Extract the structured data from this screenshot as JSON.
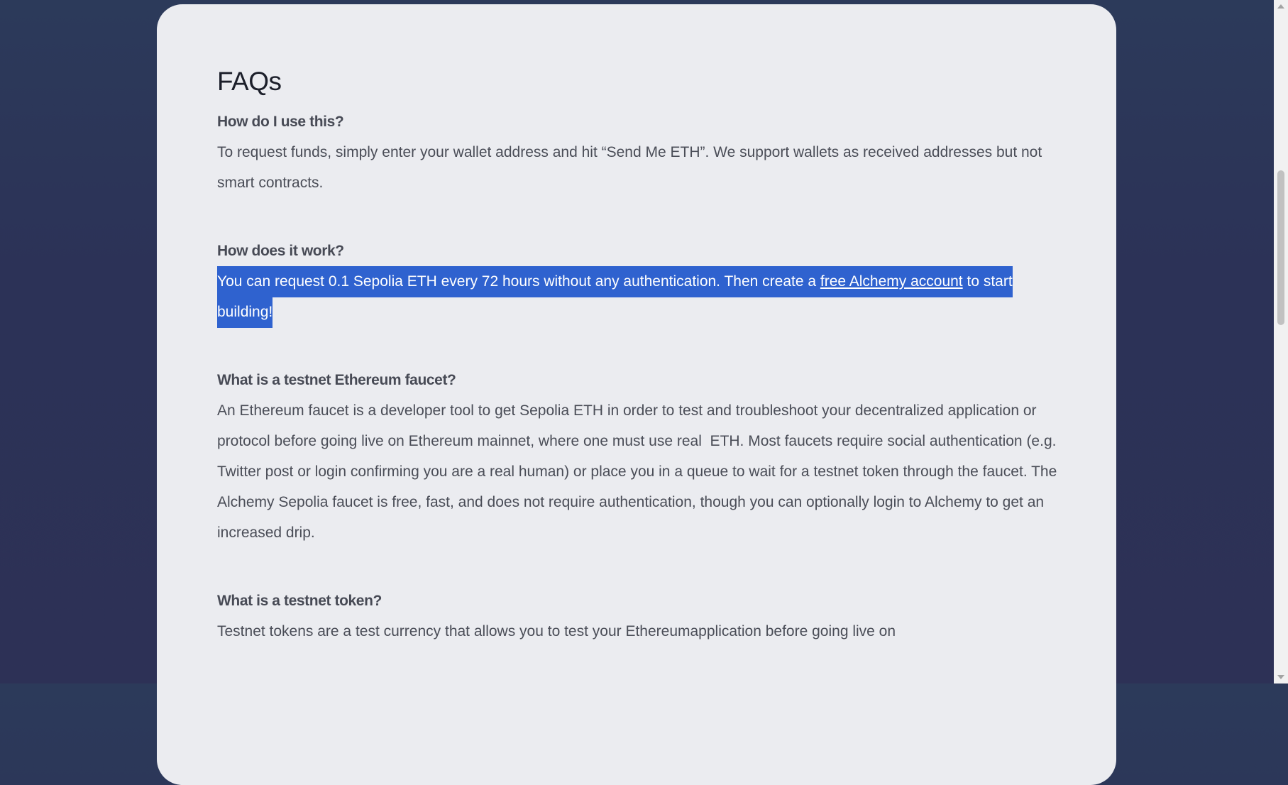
{
  "faq": {
    "title": "FAQs",
    "items": [
      {
        "question": "How do I use this?",
        "answer": "To request funds, simply enter your wallet address and hit “Send Me ETH”. We support wallets as received addresses but not smart contracts."
      },
      {
        "question": "How does it work?",
        "answer_before": "You can request 0.1 Sepolia ETH every 72 hours without any authentication. Then create a ",
        "link": "free Alchemy account",
        "answer_after": " to start building!"
      },
      {
        "question": "What is a testnet Ethereum faucet?",
        "answer": "An Ethereum faucet is a developer tool to get Sepolia ETH in order to test and troubleshoot your decentralized application or protocol before going live on Ethereum mainnet, where one must use real  ETH. Most faucets require social authentication (e.g. Twitter post or login confirming you are a real human) or place you in a queue to wait for a testnet token through the faucet. The Alchemy Sepolia faucet is free, fast, and does not require authentication, though you can optionally login to Alchemy to get an increased drip."
      },
      {
        "question": "What is a testnet token?",
        "answer": "Testnet tokens are a test currency that allows you to test your Ethereumapplication before going live on"
      }
    ]
  },
  "colors": {
    "background": "#2c3257",
    "panel": "#ebecf0",
    "selection": "#2f62cf"
  }
}
